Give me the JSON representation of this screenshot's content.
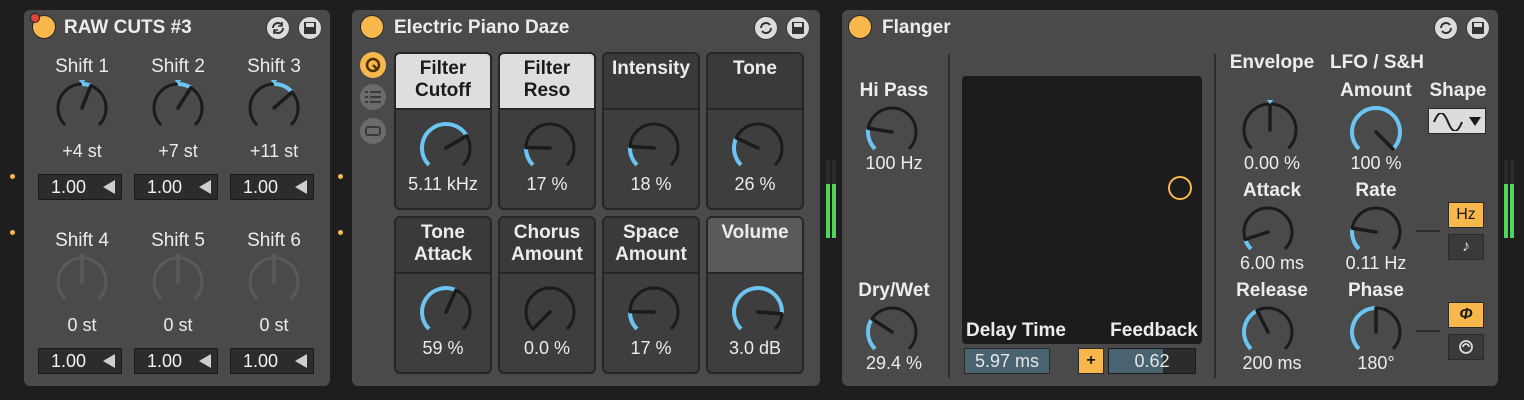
{
  "raw_cuts": {
    "title": "RAW CUTS #3",
    "shifts": [
      {
        "label": "Shift 1",
        "value": "+4 st",
        "box": "1.00",
        "amount": 0.58,
        "active": true
      },
      {
        "label": "Shift 2",
        "value": "+7 st",
        "box": "1.00",
        "amount": 0.62,
        "active": true
      },
      {
        "label": "Shift 3",
        "value": "+11 st",
        "box": "1.00",
        "amount": 0.68,
        "active": true
      },
      {
        "label": "Shift 4",
        "value": "0 st",
        "box": "1.00",
        "amount": 0.5,
        "active": false
      },
      {
        "label": "Shift 5",
        "value": "0 st",
        "box": "1.00",
        "amount": 0.5,
        "active": false
      },
      {
        "label": "Shift 6",
        "value": "0 st",
        "box": "1.00",
        "amount": 0.5,
        "active": false
      }
    ]
  },
  "electric_piano": {
    "title": "Electric Piano Daze",
    "macros": [
      {
        "l1": "Filter",
        "l2": "Cutoff",
        "value": "5.11 kHz",
        "amount": 0.72,
        "hl": true
      },
      {
        "l1": "Filter",
        "l2": "Reso",
        "value": "17 %",
        "amount": 0.17,
        "hl": true
      },
      {
        "l1": "Intensity",
        "l2": "",
        "value": "18 %",
        "amount": 0.18,
        "hl": false
      },
      {
        "l1": "Tone",
        "l2": "",
        "value": "26 %",
        "amount": 0.26,
        "hl": false
      },
      {
        "l1": "Tone",
        "l2": "Attack",
        "value": "59 %",
        "amount": 0.59,
        "hl": false
      },
      {
        "l1": "Chorus",
        "l2": "Amount",
        "value": "0.0 %",
        "amount": 0.0,
        "hl": false
      },
      {
        "l1": "Space",
        "l2": "Amount",
        "value": "17 %",
        "amount": 0.17,
        "hl": false
      },
      {
        "l1": "Volume",
        "l2": "",
        "value": "3.0 dB",
        "amount": 0.85,
        "hl": false,
        "gray": true
      }
    ]
  },
  "flanger": {
    "title": "Flanger",
    "hipass": {
      "label": "Hi Pass",
      "value": "100 Hz",
      "amount": 0.2
    },
    "drywet": {
      "label": "Dry/Wet",
      "value": "29.4 %",
      "amount": 0.29
    },
    "delay_time": {
      "label": "Delay Time",
      "value": "5.97 ms"
    },
    "feedback": {
      "label": "Feedback",
      "value": "0.62"
    },
    "plus_label": "+",
    "envelope": {
      "label": "Envelope",
      "value": "0.00 %",
      "amount": 0.5
    },
    "attack": {
      "label": "Attack",
      "value": "6.00 ms",
      "amount": 0.1
    },
    "release": {
      "label": "Release",
      "value": "200 ms",
      "amount": 0.4
    },
    "lfo": {
      "label": "LFO / S&H"
    },
    "amount": {
      "label": "Amount",
      "value": "100 %",
      "amount": 1.0
    },
    "rate": {
      "label": "Rate",
      "value": "0.11 Hz",
      "amount": 0.2
    },
    "phase": {
      "label": "Phase",
      "value": "180°",
      "amount": 0.5
    },
    "shape": {
      "label": "Shape"
    },
    "hz_label": "Hz",
    "note_label": "♪",
    "phi_label": "Φ"
  },
  "colors": {
    "accent": "#f7b74b",
    "arc": "#6cc4f2",
    "panel": "#4a4a4a",
    "meter": "#54d35a"
  },
  "icons": [
    "swap-icon",
    "save-icon",
    "sine-wave-icon",
    "chevron-down-icon"
  ]
}
